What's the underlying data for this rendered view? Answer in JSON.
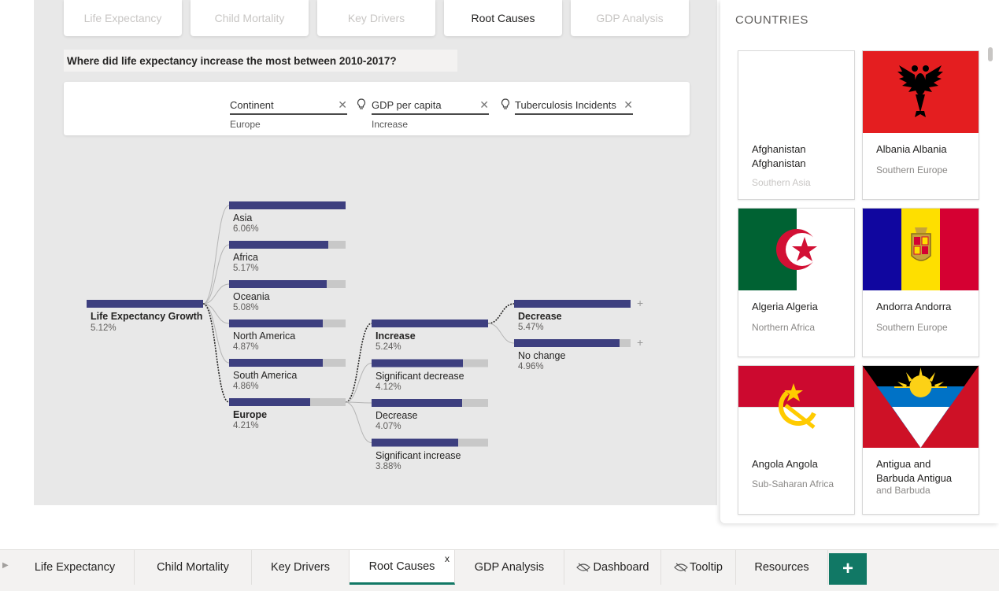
{
  "top_nav": [
    "Life Expectancy",
    "Child Mortality",
    "Key Drivers",
    "Root Causes",
    "GDP Analysis"
  ],
  "question": "Where did life expectancy increase the most between 2010-2017?",
  "filters": [
    {
      "title": "Continent",
      "value": "Europe"
    },
    {
      "title": "GDP per capita",
      "value": "Increase"
    },
    {
      "title": "Tuberculosis Incidents",
      "value": ""
    }
  ],
  "decomposition_tree": {
    "root": {
      "label": "Life Expectancy Growth",
      "value": "5.12%",
      "fill": 1.0
    },
    "level1": [
      {
        "label": "Asia",
        "value": "6.06%",
        "fill": 1.0
      },
      {
        "label": "Africa",
        "value": "5.17%",
        "fill": 0.853
      },
      {
        "label": "Oceania",
        "value": "5.08%",
        "fill": 0.838
      },
      {
        "label": "North America",
        "value": "4.87%",
        "fill": 0.804
      },
      {
        "label": "South America",
        "value": "4.86%",
        "fill": 0.802
      },
      {
        "label": "Europe",
        "value": "4.21%",
        "fill": 0.695,
        "selected": true
      }
    ],
    "level2": [
      {
        "label": "Increase",
        "value": "5.24%",
        "fill": 1.0,
        "selected": true
      },
      {
        "label": "Significant decrease",
        "value": "4.12%",
        "fill": 0.786
      },
      {
        "label": "Decrease",
        "value": "4.07%",
        "fill": 0.777
      },
      {
        "label": "Significant increase",
        "value": "3.88%",
        "fill": 0.74
      }
    ],
    "level3": [
      {
        "label": "Decrease",
        "value": "5.47%",
        "fill": 1.0,
        "bold": true
      },
      {
        "label": "No change",
        "value": "4.96%",
        "fill": 0.907
      }
    ],
    "colors": {
      "bar": "#3d3f7f",
      "track": "#c8c8c8",
      "line": "#b5b5b5",
      "path": "#252423"
    }
  },
  "countries_panel": {
    "title": "COUNTRIES",
    "cards": [
      {
        "name": "Afghanistan Afghanistan",
        "region": "Southern Asia",
        "flag": "blank-flag-icon"
      },
      {
        "name": "Albania Albania",
        "region": "Southern Europe",
        "flag": "albania-flag-icon"
      },
      {
        "name": "Algeria Algeria",
        "region": "Northern Africa",
        "flag": "algeria-flag-icon"
      },
      {
        "name": "Andorra Andorra",
        "region": "Southern Europe",
        "flag": "andorra-flag-icon"
      },
      {
        "name": "Angola Angola",
        "region": "Sub-Saharan Africa",
        "flag": "angola-flag-icon"
      },
      {
        "name": "Antigua and Barbuda Antigua",
        "region": "and Barbuda",
        "flag": "antigua-flag-icon"
      }
    ]
  },
  "bottom_tabs": [
    {
      "label": "Life Expectancy"
    },
    {
      "label": "Child Mortality"
    },
    {
      "label": "Key Drivers"
    },
    {
      "label": "Root Causes",
      "active": true,
      "close": "x"
    },
    {
      "label": "GDP Analysis"
    },
    {
      "label": "Dashboard",
      "hidden": true
    },
    {
      "label": "Tooltip",
      "hidden": true
    },
    {
      "label": "Resources"
    }
  ],
  "add_page_label": "+",
  "accent_color": "#117865"
}
